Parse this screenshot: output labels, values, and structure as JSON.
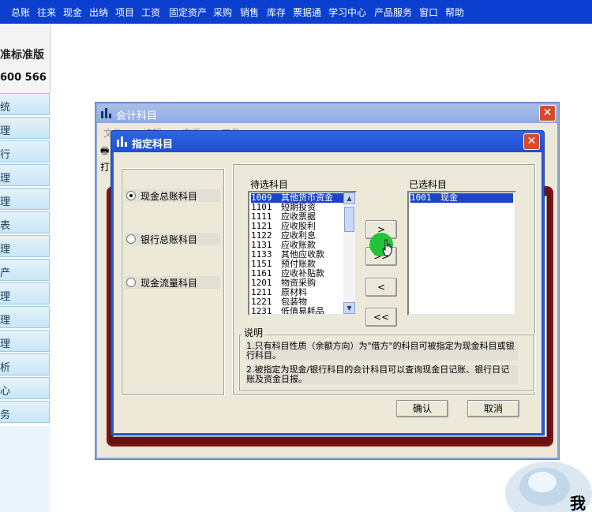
{
  "menubar": {
    "items": [
      "总账",
      "往来",
      "现金",
      "出纳",
      "项目",
      "工资",
      "固定资产",
      "采购",
      "销售",
      "库存",
      "票据通",
      "学习中心",
      "产品服务",
      "窗口",
      "帮助"
    ]
  },
  "product": {
    "name": "准标准版",
    "phone": "600 566"
  },
  "sidebar": {
    "items": [
      "统",
      "理",
      "行",
      "理",
      "理",
      "表",
      "理",
      "产",
      "理",
      "理",
      "理",
      "析",
      "心",
      "务"
    ]
  },
  "watermark": {
    "text": "我"
  },
  "account_window": {
    "title": "会计科目",
    "menu": [
      "文件",
      "编辑",
      "查看",
      "工具"
    ],
    "toolbar": [
      "打印"
    ],
    "close_label": "✕"
  },
  "dialog": {
    "title": "指定科目",
    "close_label": "✕",
    "radios": [
      {
        "label": "现金总账科目",
        "checked": true
      },
      {
        "label": "银行总账科目",
        "checked": false
      },
      {
        "label": "现金流量科目",
        "checked": false
      }
    ],
    "available_label": "待选科目",
    "available_items": [
      {
        "code": "1009",
        "name": "其他货币资金"
      },
      {
        "code": "1101",
        "name": "短期投资"
      },
      {
        "code": "1111",
        "name": "应收票据"
      },
      {
        "code": "1121",
        "name": "应收股利"
      },
      {
        "code": "1122",
        "name": "应收利息"
      },
      {
        "code": "1131",
        "name": "应收账款"
      },
      {
        "code": "1133",
        "name": "其他应收款"
      },
      {
        "code": "1151",
        "name": "预付账款"
      },
      {
        "code": "1161",
        "name": "应收补贴款"
      },
      {
        "code": "1201",
        "name": "物资采购"
      },
      {
        "code": "1211",
        "name": "原材料"
      },
      {
        "code": "1221",
        "name": "包装物"
      },
      {
        "code": "1231",
        "name": "低值易耗品"
      }
    ],
    "selected_label": "已选科目",
    "selected_items": [
      {
        "code": "1001",
        "name": "现金"
      }
    ],
    "move_buttons": [
      ">",
      ">>",
      "<",
      "<<"
    ],
    "note_title": "说明",
    "notes": [
      "1.只有科目性质（余额方向）为\"借方\"的科目可被指定为现金科目或银行科目。",
      "2.被指定为现金/银行科目的会计科目可以查询现金日记账、银行日记账及资金日报。"
    ],
    "ok_label": "确认",
    "cancel_label": "取消"
  }
}
